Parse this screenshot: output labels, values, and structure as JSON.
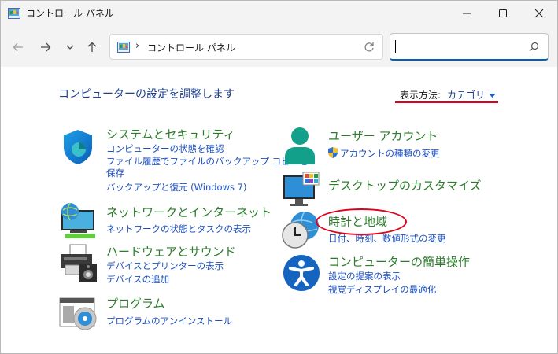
{
  "window": {
    "title": "コントロール パネル",
    "minimize_icon": "minimize-icon",
    "maximize_icon": "maximize-icon",
    "close_icon": "close-icon"
  },
  "nav": {
    "back_icon": "arrow-left-icon",
    "forward_icon": "arrow-right-icon",
    "recent_icon": "chevron-down-icon",
    "up_icon": "arrow-up-icon",
    "address_separator": "›",
    "address_text": "コントロール パネル",
    "refresh_icon": "refresh-icon",
    "search_value": "",
    "search_icon": "search-icon"
  },
  "main": {
    "page_title": "コンピューターの設定を調整します",
    "view_by_label": "表示方法:",
    "view_by_value": "カテゴリ",
    "categories": [
      {
        "title": "システムとセキュリティ",
        "icon": "shield-icon",
        "links": [
          "コンピューターの状態を確認",
          "ファイル履歴でファイルのバックアップ コピーを",
          "保存",
          "バックアップと復元 (Windows 7)"
        ]
      },
      {
        "title": "ネットワークとインターネット",
        "icon": "network-globe-icon",
        "links": [
          "ネットワークの状態とタスクの表示"
        ]
      },
      {
        "title": "ハードウェアとサウンド",
        "icon": "printer-icon",
        "links": [
          "デバイスとプリンターの表示",
          "デバイスの追加"
        ]
      },
      {
        "title": "プログラム",
        "icon": "programs-disc-icon",
        "links": [
          "プログラムのアンインストール"
        ]
      },
      {
        "title": "ユーザー アカウント",
        "icon": "user-account-icon",
        "links": [
          "アカウントの種類の変更"
        ]
      },
      {
        "title": "デスクトップのカスタマイズ",
        "icon": "monitor-icon",
        "links": []
      },
      {
        "title": "時計と地域",
        "icon": "clock-globe-icon",
        "links": [
          "日付、時刻、数値形式の変更"
        ]
      },
      {
        "title": "コンピューターの簡単操作",
        "icon": "accessibility-icon",
        "links": [
          "設定の提案の表示",
          "視覚ディスプレイの最適化"
        ]
      }
    ]
  },
  "colors": {
    "category_title": "#2c7c2c",
    "link": "#1a4fc2",
    "page_title": "#1e3f8c",
    "annotation_red": "#e0001b",
    "accent": "#005fb8"
  }
}
